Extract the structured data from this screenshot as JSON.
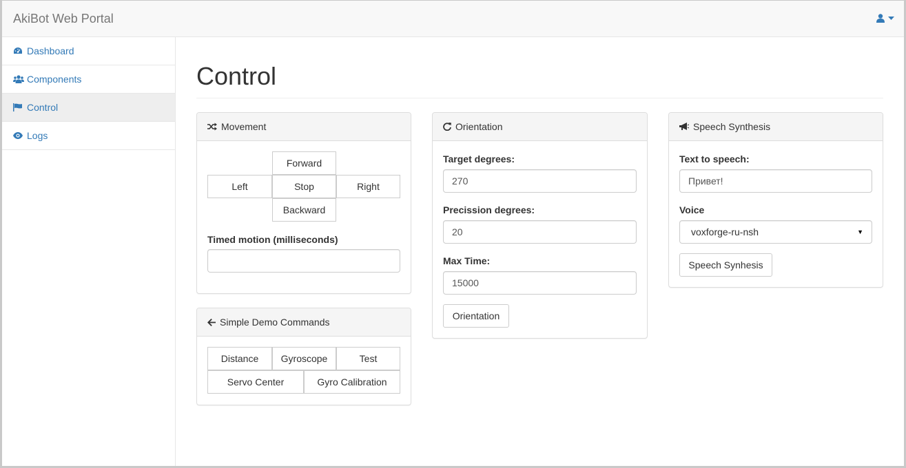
{
  "navbar": {
    "brand": "AkiBot Web Portal",
    "user_icon": "user-icon",
    "caret_icon": "caret-down-icon"
  },
  "sidebar": {
    "items": [
      {
        "label": "Dashboard",
        "icon": "dashboard-icon"
      },
      {
        "label": "Components",
        "icon": "users-icon"
      },
      {
        "label": "Control",
        "icon": "flag-icon",
        "active": true
      },
      {
        "label": "Logs",
        "icon": "eye-icon"
      }
    ]
  },
  "page": {
    "title": "Control"
  },
  "movement": {
    "title": "Movement",
    "icon": "shuffle-icon",
    "forward": "Forward",
    "left": "Left",
    "stop": "Stop",
    "right": "Right",
    "backward": "Backward",
    "timed_label": "Timed motion (milliseconds)",
    "timed_value": ""
  },
  "demo": {
    "title": "Simple Demo Commands",
    "icon": "arrow-left-icon",
    "buttons": [
      "Distance",
      "Gyroscope",
      "Test",
      "Servo Center",
      "Gyro Calibration"
    ]
  },
  "orientation": {
    "title": "Orientation",
    "icon": "refresh-icon",
    "target_label": "Target degrees:",
    "target_value": "270",
    "precision_label": "Precission degrees:",
    "precision_value": "20",
    "maxtime_label": "Max Time:",
    "maxtime_value": "15000",
    "button": "Orientation"
  },
  "speech": {
    "title": "Speech Synthesis",
    "icon": "bullhorn-icon",
    "text_label": "Text to speech:",
    "text_value": "Привет!",
    "voice_label": "Voice",
    "voice_value": "voxforge-ru-nsh",
    "button": "Speech Synhesis"
  },
  "colors": {
    "link": "#337ab7",
    "navbar_bg": "#f8f8f8",
    "panel_heading_bg": "#f5f5f5"
  }
}
